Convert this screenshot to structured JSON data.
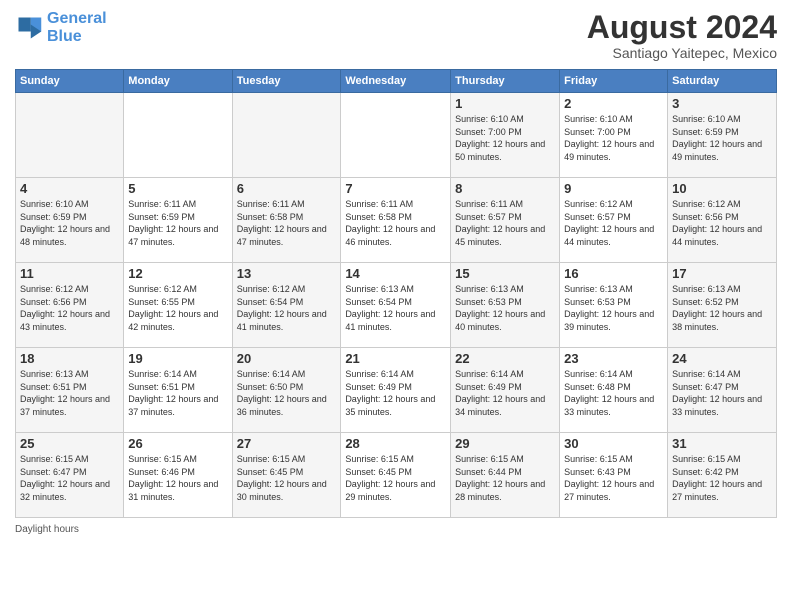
{
  "logo": {
    "line1": "General",
    "line2": "Blue"
  },
  "title": "August 2024",
  "subtitle": "Santiago Yaitepec, Mexico",
  "days_of_week": [
    "Sunday",
    "Monday",
    "Tuesday",
    "Wednesday",
    "Thursday",
    "Friday",
    "Saturday"
  ],
  "footer_text": "Daylight hours",
  "weeks": [
    [
      {
        "day": "",
        "sunrise": "",
        "sunset": "",
        "daylight": ""
      },
      {
        "day": "",
        "sunrise": "",
        "sunset": "",
        "daylight": ""
      },
      {
        "day": "",
        "sunrise": "",
        "sunset": "",
        "daylight": ""
      },
      {
        "day": "",
        "sunrise": "",
        "sunset": "",
        "daylight": ""
      },
      {
        "day": "1",
        "sunrise": "Sunrise: 6:10 AM",
        "sunset": "Sunset: 7:00 PM",
        "daylight": "Daylight: 12 hours and 50 minutes."
      },
      {
        "day": "2",
        "sunrise": "Sunrise: 6:10 AM",
        "sunset": "Sunset: 7:00 PM",
        "daylight": "Daylight: 12 hours and 49 minutes."
      },
      {
        "day": "3",
        "sunrise": "Sunrise: 6:10 AM",
        "sunset": "Sunset: 6:59 PM",
        "daylight": "Daylight: 12 hours and 49 minutes."
      }
    ],
    [
      {
        "day": "4",
        "sunrise": "Sunrise: 6:10 AM",
        "sunset": "Sunset: 6:59 PM",
        "daylight": "Daylight: 12 hours and 48 minutes."
      },
      {
        "day": "5",
        "sunrise": "Sunrise: 6:11 AM",
        "sunset": "Sunset: 6:59 PM",
        "daylight": "Daylight: 12 hours and 47 minutes."
      },
      {
        "day": "6",
        "sunrise": "Sunrise: 6:11 AM",
        "sunset": "Sunset: 6:58 PM",
        "daylight": "Daylight: 12 hours and 47 minutes."
      },
      {
        "day": "7",
        "sunrise": "Sunrise: 6:11 AM",
        "sunset": "Sunset: 6:58 PM",
        "daylight": "Daylight: 12 hours and 46 minutes."
      },
      {
        "day": "8",
        "sunrise": "Sunrise: 6:11 AM",
        "sunset": "Sunset: 6:57 PM",
        "daylight": "Daylight: 12 hours and 45 minutes."
      },
      {
        "day": "9",
        "sunrise": "Sunrise: 6:12 AM",
        "sunset": "Sunset: 6:57 PM",
        "daylight": "Daylight: 12 hours and 44 minutes."
      },
      {
        "day": "10",
        "sunrise": "Sunrise: 6:12 AM",
        "sunset": "Sunset: 6:56 PM",
        "daylight": "Daylight: 12 hours and 44 minutes."
      }
    ],
    [
      {
        "day": "11",
        "sunrise": "Sunrise: 6:12 AM",
        "sunset": "Sunset: 6:56 PM",
        "daylight": "Daylight: 12 hours and 43 minutes."
      },
      {
        "day": "12",
        "sunrise": "Sunrise: 6:12 AM",
        "sunset": "Sunset: 6:55 PM",
        "daylight": "Daylight: 12 hours and 42 minutes."
      },
      {
        "day": "13",
        "sunrise": "Sunrise: 6:12 AM",
        "sunset": "Sunset: 6:54 PM",
        "daylight": "Daylight: 12 hours and 41 minutes."
      },
      {
        "day": "14",
        "sunrise": "Sunrise: 6:13 AM",
        "sunset": "Sunset: 6:54 PM",
        "daylight": "Daylight: 12 hours and 41 minutes."
      },
      {
        "day": "15",
        "sunrise": "Sunrise: 6:13 AM",
        "sunset": "Sunset: 6:53 PM",
        "daylight": "Daylight: 12 hours and 40 minutes."
      },
      {
        "day": "16",
        "sunrise": "Sunrise: 6:13 AM",
        "sunset": "Sunset: 6:53 PM",
        "daylight": "Daylight: 12 hours and 39 minutes."
      },
      {
        "day": "17",
        "sunrise": "Sunrise: 6:13 AM",
        "sunset": "Sunset: 6:52 PM",
        "daylight": "Daylight: 12 hours and 38 minutes."
      }
    ],
    [
      {
        "day": "18",
        "sunrise": "Sunrise: 6:13 AM",
        "sunset": "Sunset: 6:51 PM",
        "daylight": "Daylight: 12 hours and 37 minutes."
      },
      {
        "day": "19",
        "sunrise": "Sunrise: 6:14 AM",
        "sunset": "Sunset: 6:51 PM",
        "daylight": "Daylight: 12 hours and 37 minutes."
      },
      {
        "day": "20",
        "sunrise": "Sunrise: 6:14 AM",
        "sunset": "Sunset: 6:50 PM",
        "daylight": "Daylight: 12 hours and 36 minutes."
      },
      {
        "day": "21",
        "sunrise": "Sunrise: 6:14 AM",
        "sunset": "Sunset: 6:49 PM",
        "daylight": "Daylight: 12 hours and 35 minutes."
      },
      {
        "day": "22",
        "sunrise": "Sunrise: 6:14 AM",
        "sunset": "Sunset: 6:49 PM",
        "daylight": "Daylight: 12 hours and 34 minutes."
      },
      {
        "day": "23",
        "sunrise": "Sunrise: 6:14 AM",
        "sunset": "Sunset: 6:48 PM",
        "daylight": "Daylight: 12 hours and 33 minutes."
      },
      {
        "day": "24",
        "sunrise": "Sunrise: 6:14 AM",
        "sunset": "Sunset: 6:47 PM",
        "daylight": "Daylight: 12 hours and 33 minutes."
      }
    ],
    [
      {
        "day": "25",
        "sunrise": "Sunrise: 6:15 AM",
        "sunset": "Sunset: 6:47 PM",
        "daylight": "Daylight: 12 hours and 32 minutes."
      },
      {
        "day": "26",
        "sunrise": "Sunrise: 6:15 AM",
        "sunset": "Sunset: 6:46 PM",
        "daylight": "Daylight: 12 hours and 31 minutes."
      },
      {
        "day": "27",
        "sunrise": "Sunrise: 6:15 AM",
        "sunset": "Sunset: 6:45 PM",
        "daylight": "Daylight: 12 hours and 30 minutes."
      },
      {
        "day": "28",
        "sunrise": "Sunrise: 6:15 AM",
        "sunset": "Sunset: 6:45 PM",
        "daylight": "Daylight: 12 hours and 29 minutes."
      },
      {
        "day": "29",
        "sunrise": "Sunrise: 6:15 AM",
        "sunset": "Sunset: 6:44 PM",
        "daylight": "Daylight: 12 hours and 28 minutes."
      },
      {
        "day": "30",
        "sunrise": "Sunrise: 6:15 AM",
        "sunset": "Sunset: 6:43 PM",
        "daylight": "Daylight: 12 hours and 27 minutes."
      },
      {
        "day": "31",
        "sunrise": "Sunrise: 6:15 AM",
        "sunset": "Sunset: 6:42 PM",
        "daylight": "Daylight: 12 hours and 27 minutes."
      }
    ]
  ]
}
